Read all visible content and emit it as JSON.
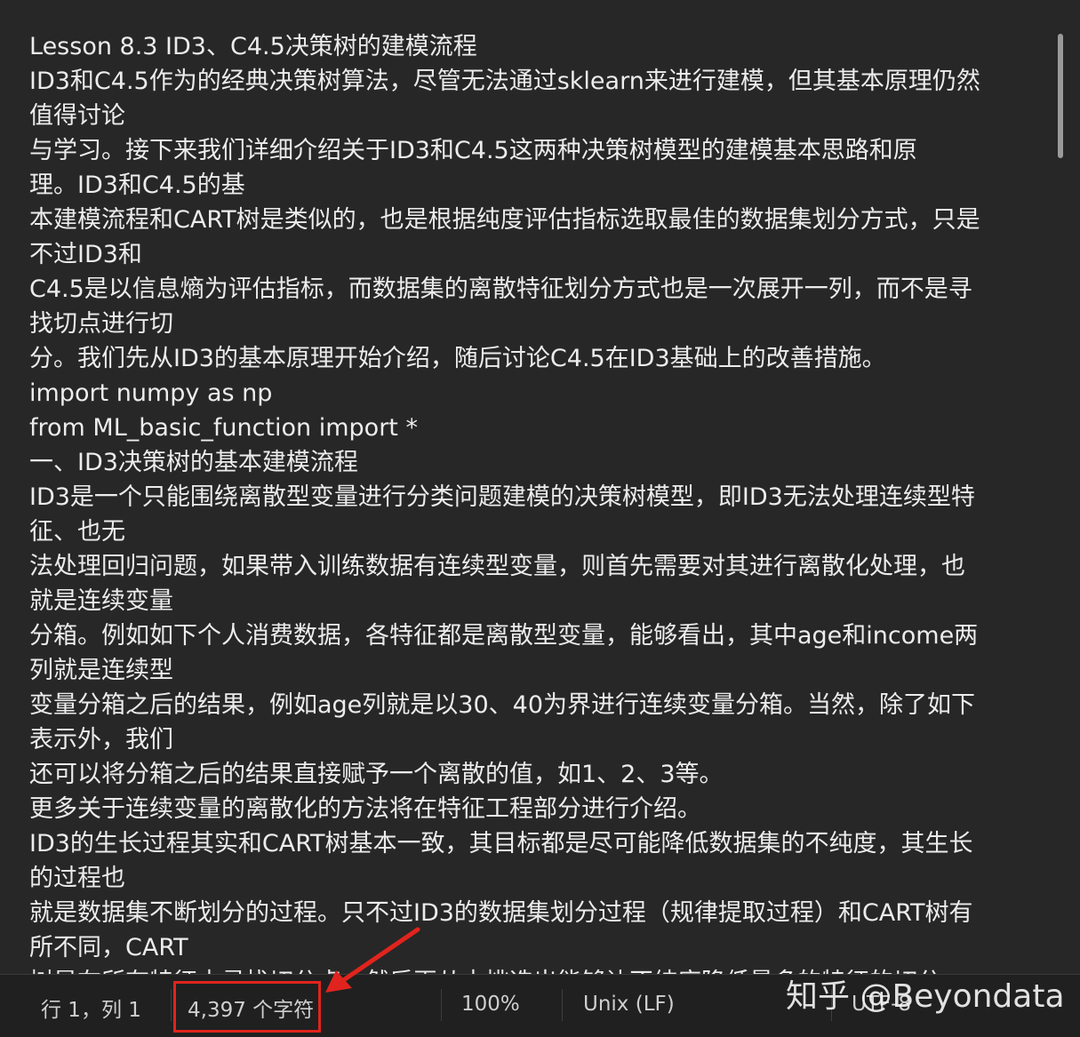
{
  "editor": {
    "lines": [
      "Lesson 8.3 ID3、C4.5决策树的建模流程",
      "ID3和C4.5作为的经典决策树算法，尽管无法通过sklearn来进行建模，但其基本原理仍然",
      "值得讨论",
      "与学习。接下来我们详细介绍关于ID3和C4.5这两种决策树模型的建模基本思路和原",
      "理。ID3和C4.5的基",
      "本建模流程和CART树是类似的，也是根据纯度评估指标选取最佳的数据集划分方式，只是",
      "不过ID3和",
      "C4.5是以信息熵为评估指标，而数据集的离散特征划分方式也是一次展开一列，而不是寻",
      "找切点进行切",
      "分。我们先从ID3的基本原理开始介绍，随后讨论C4.5在ID3基础上的改善措施。",
      "import numpy as np",
      "from ML_basic_function import *",
      "一、ID3决策树的基本建模流程",
      "ID3是一个只能围绕离散型变量进行分类问题建模的决策树模型，即ID3无法处理连续型特",
      "征、也无",
      "法处理回归问题，如果带入训练数据有连续型变量，则首先需要对其进行离散化处理，也",
      "就是连续变量",
      "分箱。例如如下个人消费数据，各特征都是离散型变量，能够看出，其中age和income两",
      "列就是连续型",
      "变量分箱之后的结果，例如age列就是以30、40为界进行连续变量分箱。当然，除了如下",
      "表示外，我们",
      "还可以将分箱之后的结果直接赋予一个离散的值，如1、2、3等。",
      "更多关于连续变量的离散化的方法将在特征工程部分进行介绍。",
      "ID3的生长过程其实和CART树基本一致，其目标都是尽可能降低数据集的不纯度，其生长",
      "的过程也",
      "就是数据集不断划分的过程。只不过ID3的数据集划分过程（规律提取过程）和CART树有",
      "所不同，CART",
      "树是在所有特征中寻找切分点，然后再从中挑选出能够让不纯度降低最多的特征的切分"
    ]
  },
  "status": {
    "position": "行 1，列 1",
    "char_count": "4,397 个字符",
    "zoom": "100%",
    "line_ending": "Unix (LF)",
    "encoding": "UTF-8"
  },
  "watermark": "知乎 @Beyondata",
  "colors": {
    "background": "#272727",
    "text": "#ececec",
    "statusbar": "#202020",
    "highlight": "#e0241d"
  }
}
